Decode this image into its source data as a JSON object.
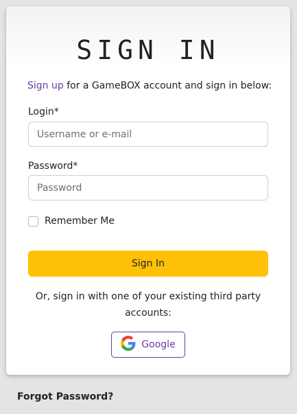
{
  "card": {
    "title": "SIGN IN",
    "intro_link": "Sign up",
    "intro_text": " for a GameBOX account and sign in below:"
  },
  "login": {
    "label": "Login*",
    "placeholder": "Username or e-mail"
  },
  "password": {
    "label": "Password*",
    "placeholder": "Password"
  },
  "remember": {
    "label": "Remember Me",
    "checked": false
  },
  "submit": {
    "label": "Sign In"
  },
  "third_party": {
    "text": "Or, sign in with one of your existing third party accounts:",
    "google_label": "Google",
    "google_icon": "google-icon"
  },
  "footer": {
    "forgot": "Forgot Password?"
  },
  "colors": {
    "accent": "#6a3aa4",
    "button": "#ffc107",
    "background": "#e4e4e4"
  }
}
